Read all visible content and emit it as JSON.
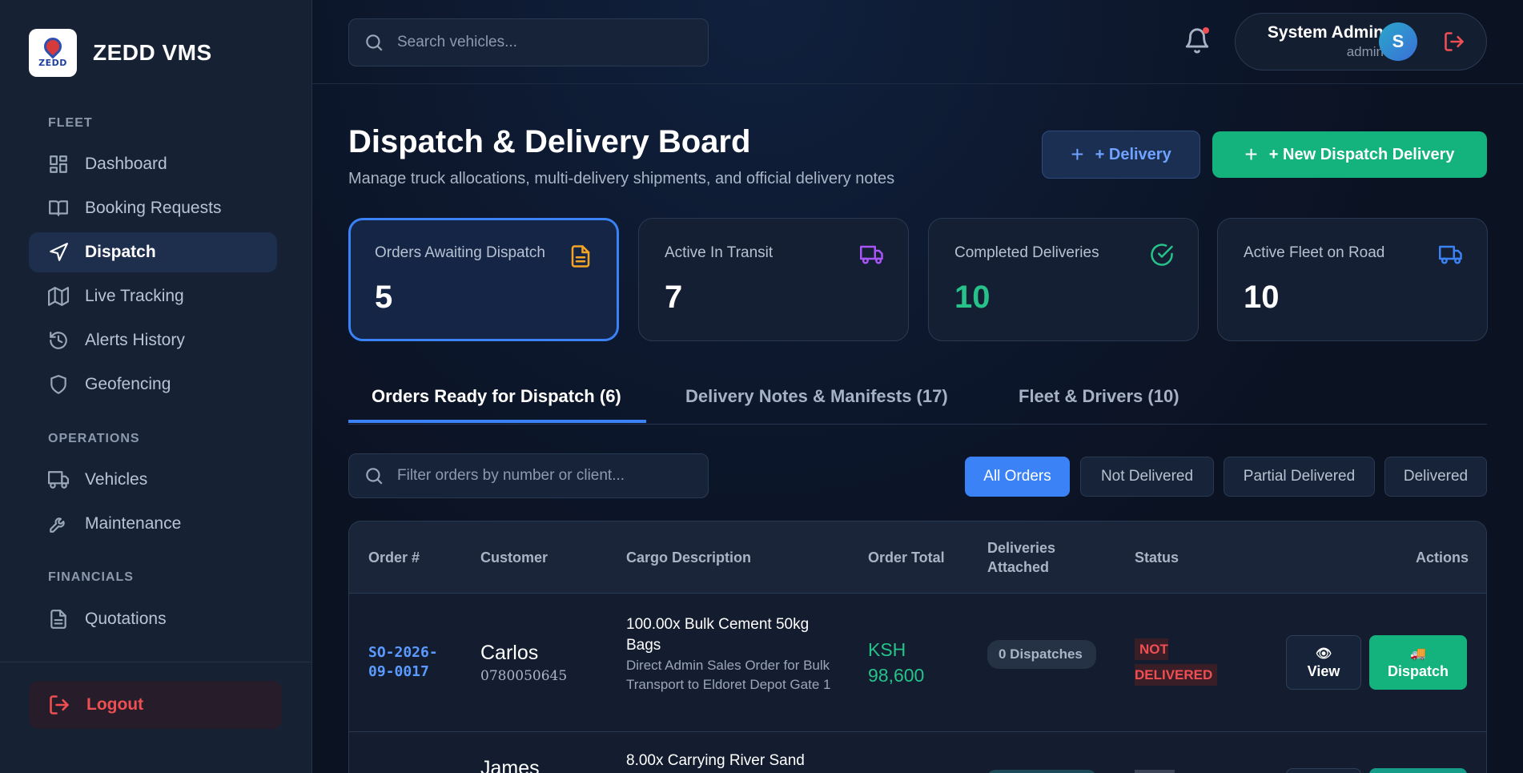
{
  "brand": {
    "name": "ZEDD VMS",
    "logo_text": "ZEDD"
  },
  "sidebar": {
    "sections": [
      {
        "label": "FLEET"
      },
      {
        "label": "OPERATIONS"
      },
      {
        "label": "FINANCIALS"
      }
    ],
    "items": [
      {
        "label": "Dashboard",
        "icon": "dashboard-icon"
      },
      {
        "label": "Booking Requests",
        "icon": "book-icon"
      },
      {
        "label": "Dispatch",
        "icon": "send-icon",
        "active": true
      },
      {
        "label": "Live Tracking",
        "icon": "map-icon"
      },
      {
        "label": "Alerts History",
        "icon": "history-icon"
      },
      {
        "label": "Geofencing",
        "icon": "shield-icon"
      },
      {
        "label": "Vehicles",
        "icon": "truck-icon"
      },
      {
        "label": "Maintenance",
        "icon": "wrench-icon"
      },
      {
        "label": "Quotations",
        "icon": "document-icon"
      }
    ],
    "logout_label": "Logout"
  },
  "topbar": {
    "search_placeholder": "Search vehicles...",
    "user_name": "System Admin",
    "user_role": "admin",
    "avatar_letter": "S"
  },
  "header": {
    "title": "Dispatch & Delivery Board",
    "subtitle": "Manage truck allocations, multi-delivery shipments, and official delivery notes",
    "delivery_button": "+ Delivery",
    "new_dispatch_button": "+ New Dispatch Delivery"
  },
  "stats": [
    {
      "label": "Orders Awaiting Dispatch",
      "value": "5",
      "icon": "file-icon",
      "color": "#f5a524"
    },
    {
      "label": "Active In Transit",
      "value": "7",
      "icon": "truck-icon",
      "color": "#a855f7"
    },
    {
      "label": "Completed Deliveries",
      "value": "10",
      "icon": "check-circle-icon",
      "color": "#27c28a"
    },
    {
      "label": "Active Fleet on Road",
      "value": "10",
      "icon": "truck-icon",
      "color": "#3b82f6"
    }
  ],
  "tabs": [
    {
      "label": "Orders Ready for Dispatch (6)",
      "active": true
    },
    {
      "label": "Delivery Notes & Manifests (17)"
    },
    {
      "label": "Fleet & Drivers (10)"
    }
  ],
  "filter": {
    "placeholder": "Filter orders by number or client...",
    "chips": [
      "All Orders",
      "Not Delivered",
      "Partial Delivered",
      "Delivered"
    ]
  },
  "table": {
    "columns": [
      "Order #",
      "Customer",
      "Cargo Description",
      "Order Total",
      "Deliveries Attached",
      "Status",
      "Actions"
    ],
    "rows": [
      {
        "order_no": "SO-2026-09-0017",
        "customer": "Carlos",
        "phone": "0780050645",
        "cargo": "100.00x Bulk Cement 50kg Bags",
        "cargo_note": "Direct Admin Sales Order for Bulk Transport to Eldoret Depot Gate 1",
        "total": "KSH 98,600",
        "deliveries": "0 Dispatches",
        "status": "NOT DELIVERED",
        "view_label": "View",
        "dispatch_label": "Dispatch"
      },
      {
        "customer": "James",
        "cargo": "8.00x Carrying River Sand"
      }
    ]
  }
}
